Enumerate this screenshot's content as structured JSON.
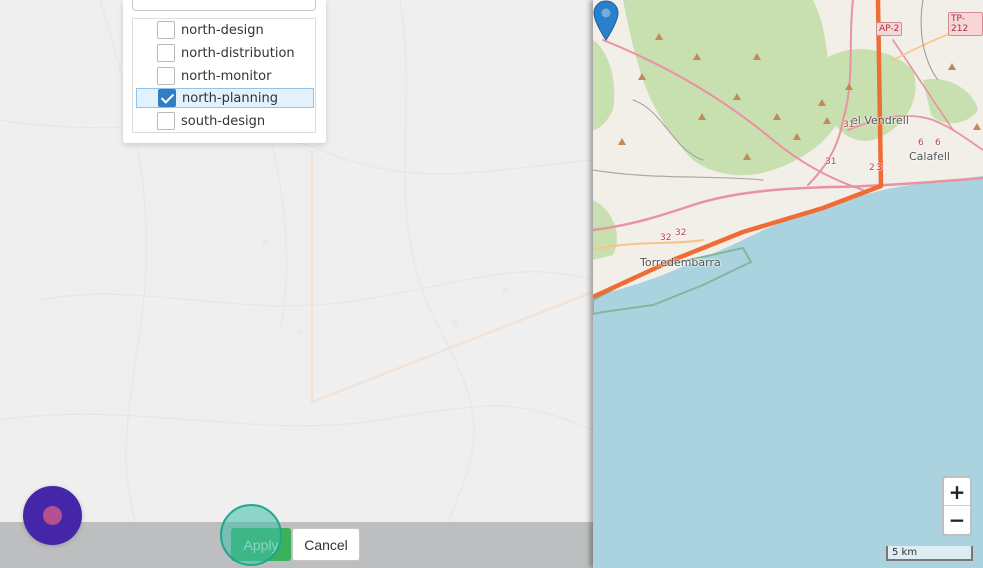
{
  "layer_list": {
    "items": [
      {
        "label": "north-design",
        "checked": false
      },
      {
        "label": "north-distribution",
        "checked": false
      },
      {
        "label": "north-monitor",
        "checked": false
      },
      {
        "label": "north-planning",
        "checked": true
      },
      {
        "label": "south-design",
        "checked": false
      }
    ]
  },
  "actions": {
    "apply_label": "Apply",
    "cancel_label": "Cancel"
  },
  "map": {
    "places": [
      "el Vendrell",
      "Calafell",
      "Torredembarra"
    ],
    "road_shields": [
      "AP-2",
      "TP-212"
    ],
    "road_numbers": [
      "32",
      "32",
      "31",
      "6",
      "6",
      "2",
      "3",
      "31"
    ],
    "zoom_in_label": "+",
    "zoom_out_label": "−",
    "scale_label": "5 km",
    "marker_icon": "map-pin-icon",
    "colors": {
      "sea": "#aad3df",
      "land": "#f2efe9",
      "forest": "#c8e0b0",
      "route": "#ef6c35",
      "marker": "#2a81cb"
    }
  },
  "colors": {
    "apply_button": "#3bb05b",
    "bottom_bar": "#bcbebf",
    "selected_item": "#e3f1fd"
  }
}
